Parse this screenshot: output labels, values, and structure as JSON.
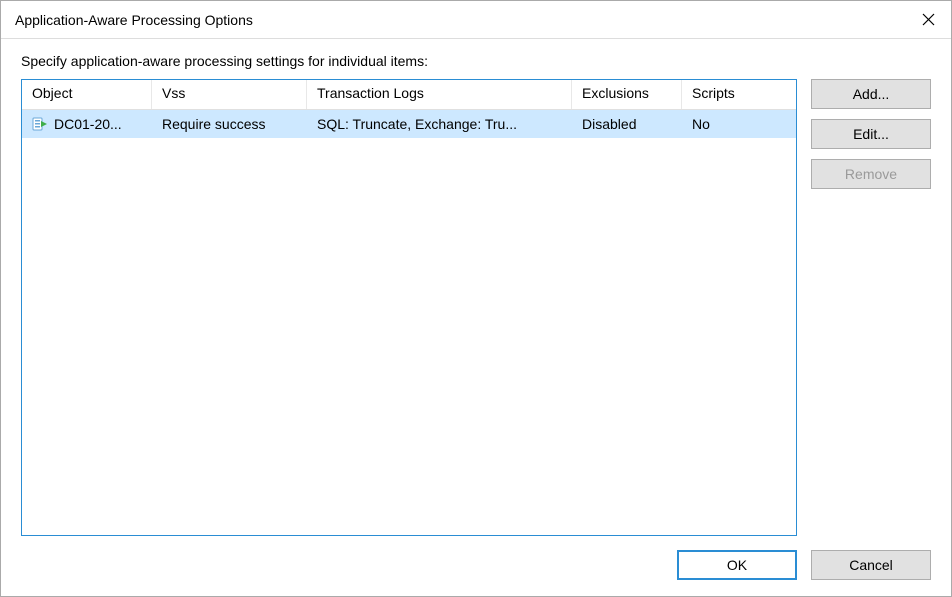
{
  "window": {
    "title": "Application-Aware Processing Options"
  },
  "description": "Specify application-aware processing settings for individual items:",
  "grid": {
    "columns": {
      "object": "Object",
      "vss": "Vss",
      "tlogs": "Transaction Logs",
      "exclusions": "Exclusions",
      "scripts": "Scripts"
    },
    "rows": [
      {
        "object": "DC01-20...",
        "vss": "Require success",
        "tlogs": "SQL: Truncate, Exchange: Tru...",
        "exclusions": "Disabled",
        "scripts": "No"
      }
    ]
  },
  "buttons": {
    "add": "Add...",
    "edit": "Edit...",
    "remove": "Remove",
    "ok": "OK",
    "cancel": "Cancel"
  }
}
